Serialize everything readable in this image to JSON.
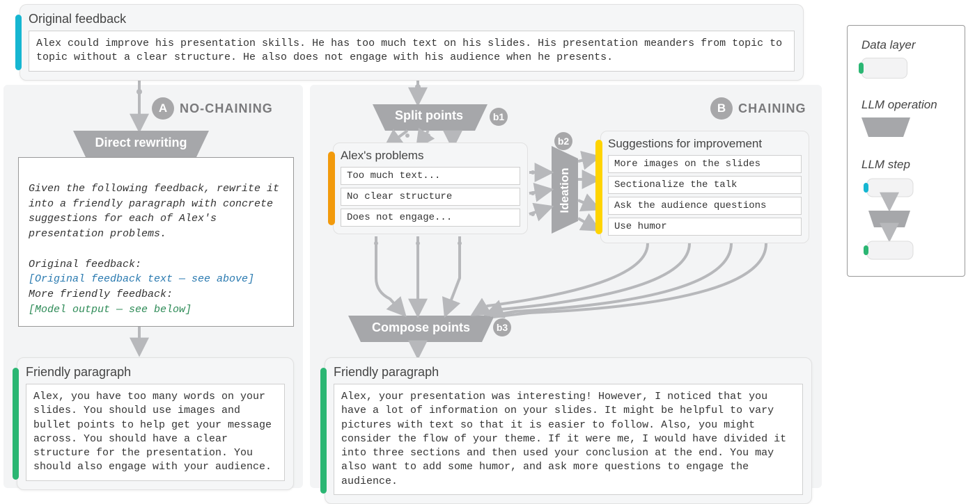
{
  "original": {
    "title": "Original feedback",
    "text": "Alex could improve his presentation skills. He has too much text on his slides. His presentation meanders from topic to topic without a clear structure. He also does not engage with his audience when he presents."
  },
  "sections": {
    "a_label": "NO-CHAINING",
    "b_label": "CHAINING",
    "a_badge": "A",
    "b_badge": "B",
    "b1": "b1",
    "b2": "b2",
    "b3": "b3"
  },
  "ops": {
    "direct": "Direct rewriting",
    "split": "Split points",
    "ideation": "Ideation",
    "compose": "Compose points"
  },
  "prompt": {
    "instr": "Given the following feedback, rewrite it into a friendly paragraph with concrete suggestions for each of Alex's presentation problems.",
    "orig_label": "Original feedback:",
    "orig_placeholder": "[Original feedback text — see above]",
    "more_label": "More friendly feedback:",
    "output_placeholder": "[Model output — see below]"
  },
  "problems": {
    "title": "Alex's problems",
    "items": [
      "Too much text...",
      "No clear structure",
      "Does not engage..."
    ]
  },
  "suggestions": {
    "title": "Suggestions for improvement",
    "items": [
      "More images on the slides",
      "Sectionalize the talk",
      "Ask the audience questions",
      "Use humor"
    ]
  },
  "friendly_a": {
    "title": "Friendly paragraph",
    "text": "Alex, you have too many words on your slides. You should use images and bullet points to help get your message across. You should have a clear structure for the presentation. You should also engage with your audience."
  },
  "friendly_b": {
    "title": "Friendly paragraph",
    "text": "Alex, your presentation was interesting! However, I noticed that you have a lot of information on your slides. It might be helpful to vary pictures with text so that it is easier to follow. Also, you might consider the flow of your theme. If it were me, I would have divided it into three sections and then used your conclusion at the end. You may also want to add some humor, and ask more questions to engage the audience."
  },
  "legend": {
    "data_layer": "Data layer",
    "llm_op": "LLM operation",
    "llm_step": "LLM step"
  },
  "colors": {
    "cyan": "#16b6d1",
    "green": "#2bb673",
    "orange": "#f29a0c",
    "yellow": "#ffd400",
    "grey_op": "#a6a7aa",
    "grey_arrow": "#b7b8bb"
  }
}
